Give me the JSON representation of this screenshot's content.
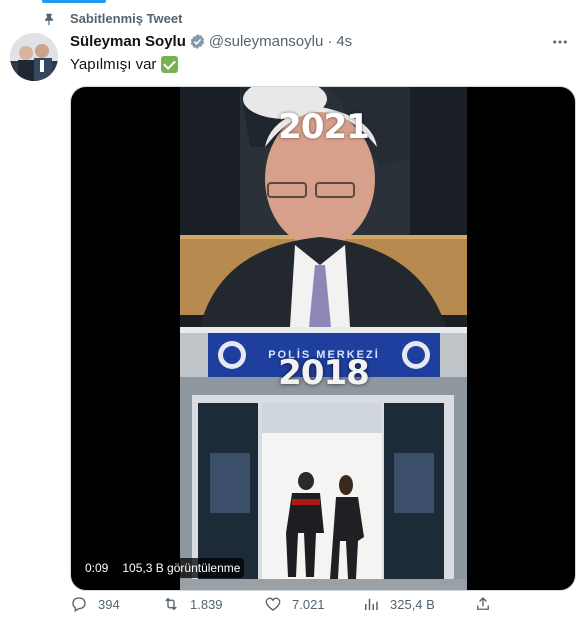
{
  "pinned": {
    "label": "Sabitlenmiş Tweet"
  },
  "author": {
    "display_name": "Süleyman Soylu",
    "handle": "@suleymansoylu",
    "separator": "·",
    "time": "4s"
  },
  "tweet": {
    "text": "Yapılmışı var"
  },
  "media": {
    "top_year": "2021",
    "bottom_year": "2018",
    "sign_text": "POLİS MERKEZİ",
    "timestamp": "0:09",
    "views": "105,3 B görüntülenme"
  },
  "actions": {
    "replies": "394",
    "retweets": "1.839",
    "likes": "7.021",
    "views": "325,4 B"
  },
  "colors": {
    "accent": "#1d9bf0",
    "text": "#0f1419",
    "muted": "#536471",
    "check_emoji": "#77b255"
  },
  "icons": [
    "pin-icon",
    "verified-icon",
    "more-icon",
    "reply-icon",
    "retweet-icon",
    "like-icon",
    "views-icon",
    "share-icon"
  ]
}
